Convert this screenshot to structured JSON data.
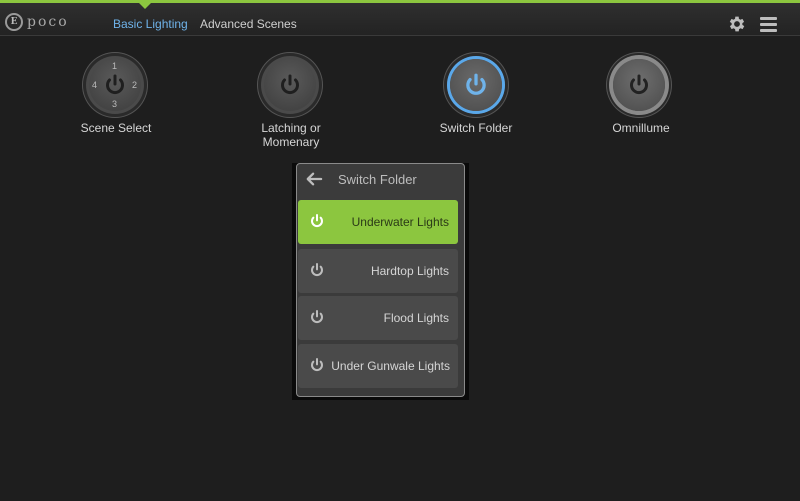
{
  "app": {
    "logo_mark": "E",
    "logo_text": "poco"
  },
  "nav": {
    "tabs": [
      {
        "label": "Basic Lighting",
        "active": true
      },
      {
        "label": "Advanced Scenes",
        "active": false
      }
    ],
    "settings_icon": "gear-icon",
    "menu_icon": "hamburger-menu-icon"
  },
  "buttons": [
    {
      "label": "Scene Select",
      "numbers": [
        "1",
        "2",
        "3",
        "4"
      ]
    },
    {
      "label_line1": "Latching or",
      "label_line2": "Momenary"
    },
    {
      "label": "Switch Folder",
      "state": "on"
    },
    {
      "label": "Omnillume"
    }
  ],
  "dialog": {
    "title": "Switch Folder",
    "back_icon": "back-arrow-icon",
    "items": [
      {
        "label": "Underwater Lights",
        "on": true
      },
      {
        "label": "Hardtop Lights",
        "on": false
      },
      {
        "label": "Flood Lights",
        "on": false
      },
      {
        "label": "Under Gunwale Lights",
        "on": false
      }
    ]
  },
  "colors": {
    "accent_green": "#8cc63f",
    "accent_blue": "#6fb3ea",
    "background": "#1e1e1e"
  }
}
